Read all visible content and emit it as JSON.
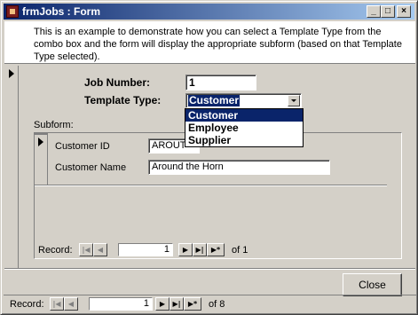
{
  "window": {
    "title": "frmJobs : Form",
    "controls": {
      "minimize": "_",
      "maximize": "□",
      "close": "×"
    }
  },
  "intro": {
    "text": "This is an example to demonstrate how you can select a Template Type from the combo box and the form will display the appropriate subform (based on that Template Type selected)."
  },
  "form": {
    "job_number_label": "Job Number:",
    "job_number_value": "1",
    "template_type_label": "Template Type:",
    "template_type_value": "Customer",
    "template_options": [
      "Customer",
      "Employee",
      "Supplier"
    ],
    "subform_label": "Subform:"
  },
  "subform": {
    "customer_id_label": "Customer ID",
    "customer_id_value": "AROUT",
    "customer_name_label": "Customer Name",
    "customer_name_value": "Around the Horn",
    "nav": {
      "label": "Record:",
      "current": "1",
      "of_text": "of  1"
    }
  },
  "main_nav": {
    "label": "Record:",
    "current": "1",
    "of_text": "of  8"
  },
  "close_button": "Close",
  "colors": {
    "titlebar_start": "#0a246a",
    "titlebar_end": "#a6caf0",
    "face": "#d4d0c8"
  },
  "icons": [
    "form-icon",
    "first-record-icon",
    "prev-record-icon",
    "next-record-icon",
    "last-record-icon",
    "new-record-icon",
    "record-selector-arrow-icon",
    "dropdown-arrow-icon"
  ]
}
